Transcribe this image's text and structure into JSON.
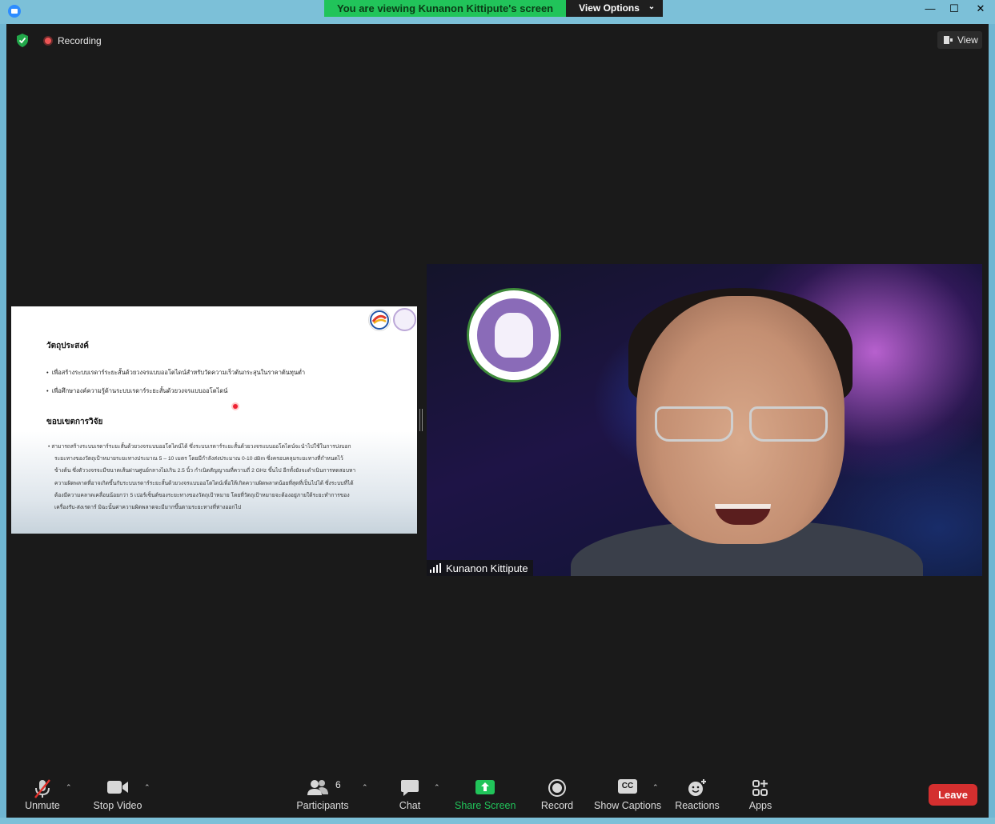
{
  "banner": {
    "viewing_text": "You are viewing Kunanon Kittipute's screen",
    "view_options_label": "View Options"
  },
  "window_controls": {
    "minimize": "—",
    "maximize": "☐",
    "close": "✕"
  },
  "meeting": {
    "recording_label": "Recording",
    "view_label": "View",
    "security_color": "#22a84a"
  },
  "slide": {
    "heading_objectives": "วัตถุประสงค์",
    "objectives": [
      "เพื่อสร้างระบบเรดาร์ระยะสั้นด้วยวงจรแบบออโตไดน์สำหรับวัดความเร็วต้นกระสุนในราคาต้นทุนต่ำ",
      "เพื่อศึกษาองค์ความรู้ด้านระบบเรดาร์ระยะสั้นด้วยวงจรแบบออโตไดน์"
    ],
    "heading_scope": "ขอบเขตการวิจัย",
    "scope_lines": [
      "•  สามารถสร้างระบบเรดาร์ระยะสั้นด้วยวงจรแบบออโตไดน์ได้      ซึ่งระบบเรดาร์ระยะสั้นด้วยวงจรแบบออโตไดน์จะนำไปใช้ในการบ่งบอก",
      "ระยะทางของวัตถุเป้าหมายระยะทางประมาณ  5  –  10  เมตร  โดยมีกำลังส่งประมาณ  0-10  dBm  ซึ่งครอบคลุมระยะทางที่กำหนดไว้",
      "ข้างต้น  ซึ่งตัววงจรจะมีขนาดเส้นผ่านศูนย์กลางไม่เกิน  2.5  นิ้ว  กำเนิดสัญญาณที่ความถี่  2  GHz  ขึ้นไป  อีกทั้งยังจะดำเนินการทดสอบหา",
      "ความผิดพลาดที่อาจเกิดขึ้นกับระบบเรดาร์ระยะสั้นด้วยวงจรแบบออโตไดน์เพื่อให้เกิดความผิดพลาดน้อยที่สุดที่เป็นไปได้       ซึ่งระบบที่ได้",
      "ต้องมีความคลาดเคลื่อนน้อยกว่า    5    เปอร์เซ็นต์ของระยะทางของวัตถุเป้าหมาย    โดยที่วัตถุเป้าหมายจะต้องอยู่ภายใต้ระยะทำการของ",
      "เครื่องรับ-ส่งเรดาร์ มิฉะนั้นค่าความผิดพลาดจะมีมากขึ้นตามระยะทางที่ห่างออกไป"
    ]
  },
  "participant": {
    "name": "Kunanon Kittipute"
  },
  "toolbar": {
    "unmute": "Unmute",
    "stop_video": "Stop Video",
    "participants": "Participants",
    "participants_count": "6",
    "chat": "Chat",
    "share_screen": "Share Screen",
    "record": "Record",
    "show_captions": "Show Captions",
    "captions_icon_text": "CC",
    "reactions": "Reactions",
    "apps": "Apps",
    "leave": "Leave",
    "share_color": "#21c45a",
    "leave_color": "#d42f2f"
  }
}
